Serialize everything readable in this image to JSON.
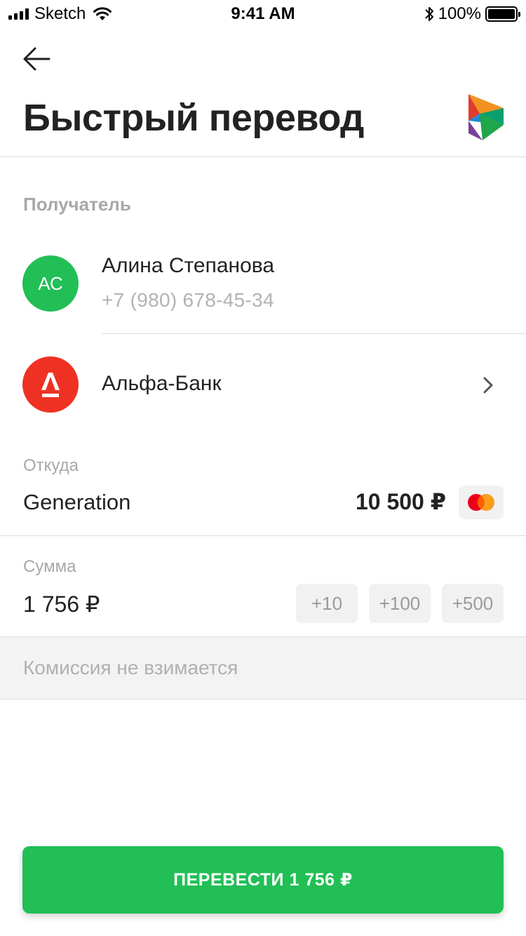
{
  "status_bar": {
    "carrier": "Sketch",
    "time": "9:41 AM",
    "battery": "100%",
    "icons": [
      "signal-icon",
      "wifi-icon",
      "bluetooth-icon",
      "battery-icon"
    ]
  },
  "header": {
    "back_icon": "arrow-left-icon",
    "title": "Быстрый перевод",
    "logo_icon": "sbp-logo-icon"
  },
  "recipient": {
    "section_label": "Получатель",
    "avatar_initials": "АС",
    "name": "Алина Степанова",
    "phone": "+7 (980) 678-45-34",
    "bank_name": "Альфа-Банк",
    "bank_icon": "alfa-bank-icon",
    "chevron_icon": "chevron-right-icon"
  },
  "source": {
    "label": "Откуда",
    "account_name": "Generation",
    "balance": "10 500 ₽",
    "card_icon": "mastercard-icon"
  },
  "amount": {
    "label": "Сумма",
    "value": "1 756 ₽",
    "quick_add": [
      "+10",
      "+100",
      "+500"
    ]
  },
  "commission": "Комиссия не взимается",
  "submit_label": "ПЕРЕВЕСТИ 1 756 ₽",
  "colors": {
    "primary_green": "#21bf55",
    "alfa_red": "#ef3124",
    "muted_text": "#a8a8a8"
  }
}
